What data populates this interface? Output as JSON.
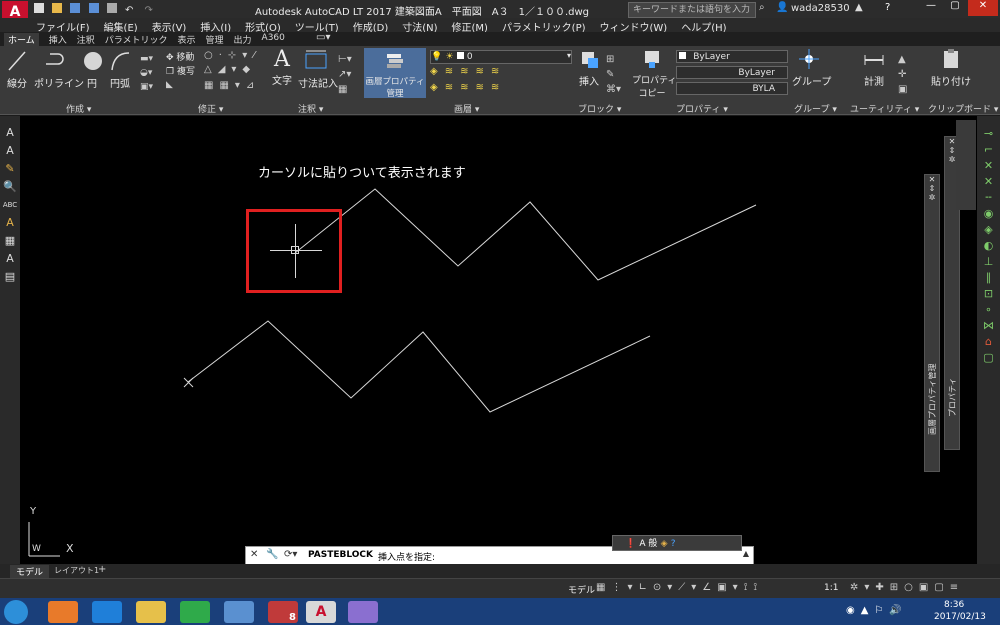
{
  "titlebar": {
    "app_title": "Autodesk AutoCAD LT 2017    建築図面A　平面図　A３　1／１００.dwg",
    "search_placeholder": "キーワードまたは語句を入力",
    "user": "wada28530"
  },
  "menu": [
    "ファイル(F)",
    "編集(E)",
    "表示(V)",
    "挿入(I)",
    "形式(O)",
    "ツール(T)",
    "作成(D)",
    "寸法(N)",
    "修正(M)",
    "パラメトリック(P)",
    "ウィンドウ(W)",
    "ヘルプ(H)"
  ],
  "ribbon_tabs": [
    "ホーム",
    "挿入",
    "注釈",
    "パラメトリック",
    "表示",
    "管理",
    "出力",
    "A360"
  ],
  "ribbon": {
    "draw": {
      "line": "線分",
      "polyline": "ポリライン",
      "circle": "円",
      "arc": "円弧",
      "group": "作成 ▾"
    },
    "modify": {
      "move": "移動",
      "copy": "複写",
      "group": "修正 ▾"
    },
    "annotation": {
      "text": "文字",
      "dimension": "寸法記入",
      "group": "注釈 ▾"
    },
    "layers": {
      "layer_props": "画層プロパティ",
      "manage": "管理",
      "layer_value": "0",
      "group": "画層 ▾"
    },
    "block": {
      "insert": "挿入",
      "group": "ブロック ▾"
    },
    "properties": {
      "match": "プロパティ",
      "copy": "コピー",
      "bylayer1": "ByLayer",
      "bylayer2": "ByLayer",
      "bylayer3": "BYLA",
      "group": "プロパティ ▾"
    },
    "groups": {
      "group": "グループ",
      "label": "グループ ▾"
    },
    "utilities": {
      "measure": "計測",
      "label": "ユーティリティ ▾"
    },
    "clipboard": {
      "paste": "貼り付け",
      "label": "クリップボード ▾"
    }
  },
  "canvas": {
    "annotation_text": "カーソルに貼りついて表示されます",
    "ucs_y": "Y",
    "ucs_w": "W",
    "ucs_x": "X"
  },
  "palette_right": {
    "label1": "プロパティ",
    "label2": "画層プロパティ管理"
  },
  "command_line": {
    "command": "PASTEBLOCK",
    "prompt": "挿入点を指定:"
  },
  "ime": {
    "mode": "A 般"
  },
  "layout_tabs": [
    "モデル",
    "レイアウト1"
  ],
  "status": {
    "model": "モデル",
    "scale": "1:1"
  },
  "taskbar": {
    "time": "8:36",
    "date": "2017/02/13",
    "badge": "8"
  },
  "colors": {
    "accent": "#1f6fd1",
    "red": "#e02020",
    "canvas": "#000000"
  }
}
